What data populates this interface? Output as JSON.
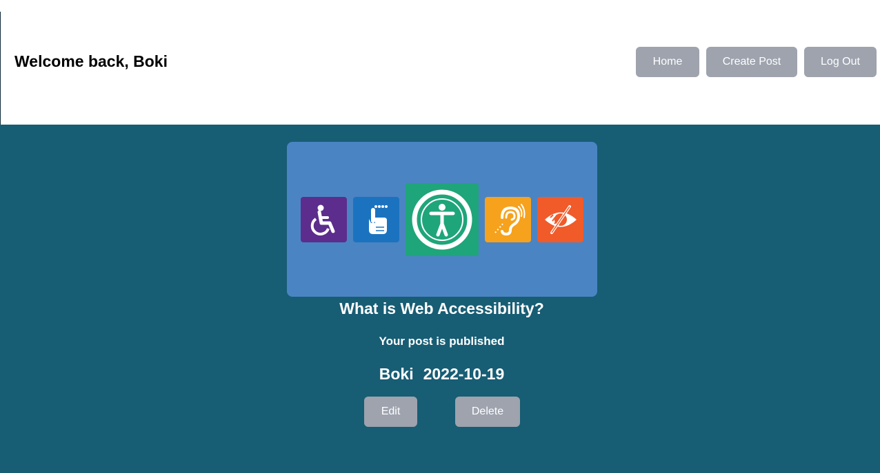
{
  "header": {
    "welcome": "Welcome back, Boki",
    "nav": {
      "home": "Home",
      "create_post": "Create Post",
      "log_out": "Log Out"
    }
  },
  "post": {
    "banner_icons": [
      "wheelchair-icon",
      "braille-hand-icon",
      "accessibility-icon",
      "hearing-ear-icon",
      "low-vision-eye-icon"
    ],
    "title": "What is Web Accessibility?",
    "status": "Your post is published",
    "author": "Boki",
    "date": "2022-10-19",
    "actions": {
      "edit": "Edit",
      "delete": "Delete"
    }
  },
  "colors": {
    "header_bg": "#ffffff",
    "main_bg": "#175d74",
    "banner_bg": "#4b84c3",
    "button_bg": "#9ea3ae"
  }
}
